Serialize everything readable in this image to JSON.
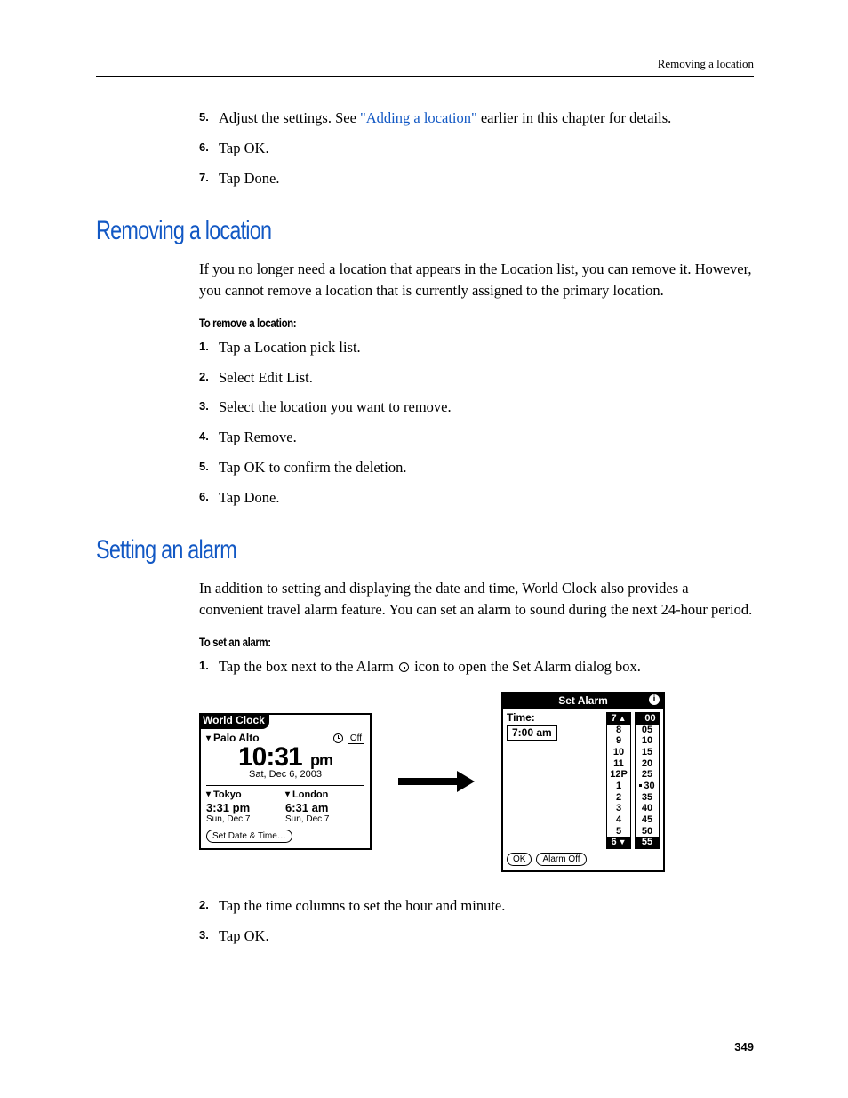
{
  "header": {
    "running": "Removing a location"
  },
  "intro_steps": [
    {
      "n": "5.",
      "before": "Adjust the settings. See ",
      "link": "\"Adding a location\"",
      "after": " earlier in this chapter for details."
    },
    {
      "n": "6.",
      "text": "Tap OK."
    },
    {
      "n": "7.",
      "text": "Tap Done."
    }
  ],
  "sec1": {
    "title": "Removing a location",
    "para": "If you no longer need a location that appears in the Location list, you can remove it. However, you cannot remove a location that is currently assigned to the primary location.",
    "sub": "To remove a location:",
    "steps": [
      {
        "n": "1.",
        "text": "Tap a Location pick list."
      },
      {
        "n": "2.",
        "text": "Select Edit List."
      },
      {
        "n": "3.",
        "text": "Select the location you want to remove."
      },
      {
        "n": "4.",
        "text": "Tap Remove."
      },
      {
        "n": "5.",
        "text": "Tap OK to confirm the deletion."
      },
      {
        "n": "6.",
        "text": "Tap Done."
      }
    ]
  },
  "sec2": {
    "title": "Setting an alarm",
    "para": "In addition to setting and displaying the date and time, World Clock also provides a convenient travel alarm feature. You can set an alarm to sound during the next 24-hour period.",
    "sub": "To set an alarm:",
    "step1": {
      "n": "1.",
      "before": "Tap the box next to the Alarm ",
      "after": " icon to open the Set Alarm dialog box."
    },
    "figure": {
      "wc": {
        "title": "World Clock",
        "primary": "Palo Alto",
        "alarm_off": "Off",
        "time": "10:31",
        "ampm": "pm",
        "date": "Sat, Dec 6, 2003",
        "c1": {
          "city": "Tokyo",
          "time": "3:31 pm",
          "date": "Sun, Dec 7"
        },
        "c2": {
          "city": "London",
          "time": "6:31 am",
          "date": "Sun, Dec 7"
        },
        "set_btn": "Set Date & Time…"
      },
      "sa": {
        "title": "Set Alarm",
        "time_lbl": "Time:",
        "time_val": "7:00 am",
        "hours": [
          "7",
          "8",
          "9",
          "10",
          "11",
          "12P",
          "1",
          "2",
          "3",
          "4",
          "5",
          "6"
        ],
        "mins": [
          "00",
          "05",
          "10",
          "15",
          "20",
          "25",
          "30",
          "35",
          "40",
          "45",
          "50",
          "55"
        ],
        "ok": "OK",
        "alarm_off": "Alarm Off"
      }
    },
    "steps_after": [
      {
        "n": "2.",
        "text": "Tap the time columns to set the hour and minute."
      },
      {
        "n": "3.",
        "text": "Tap OK."
      }
    ]
  },
  "page_number": "349",
  "chart_data": {
    "type": "table",
    "note": "no chart on this page"
  }
}
